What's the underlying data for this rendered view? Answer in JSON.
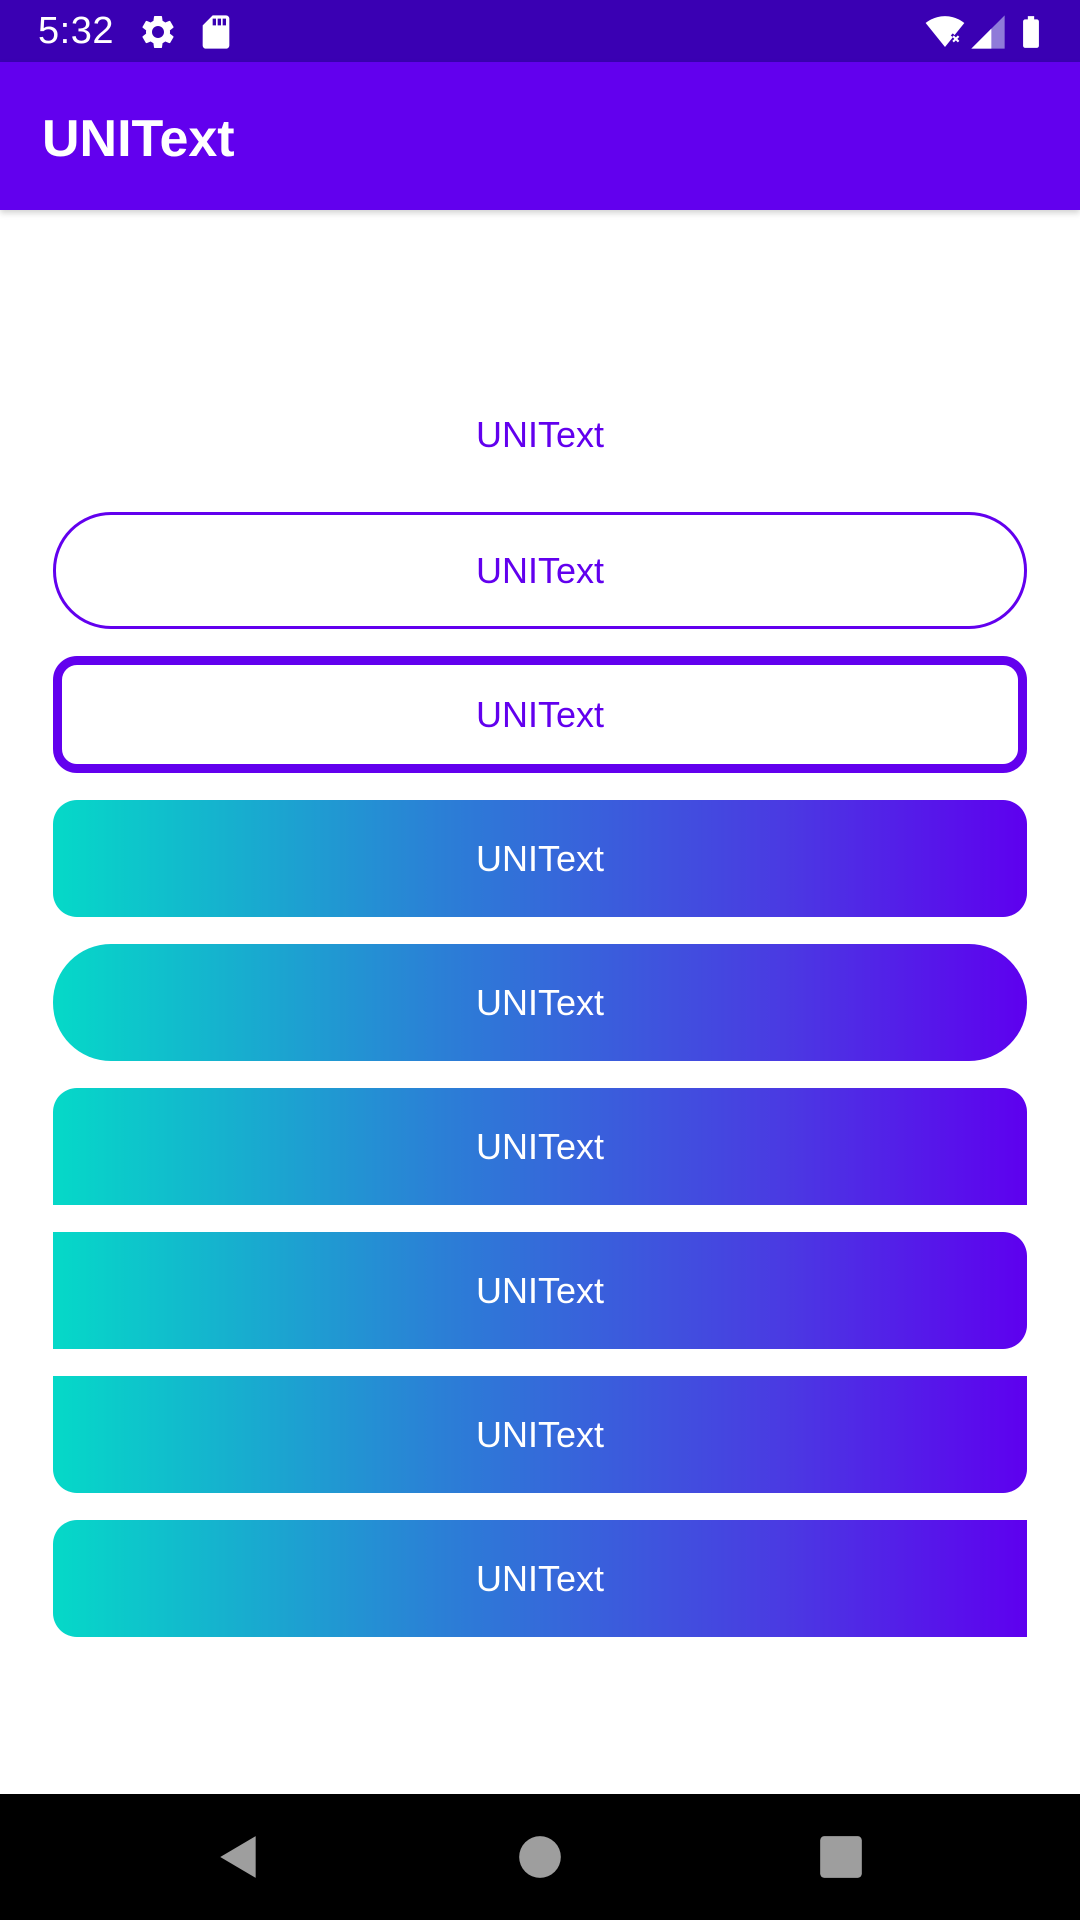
{
  "status_bar": {
    "time": "5:32",
    "icons": [
      "settings-icon",
      "sd-card-icon",
      "wifi-icon",
      "cell-signal-icon",
      "battery-icon"
    ],
    "background": "#3a00b3"
  },
  "app_bar": {
    "title": "UNIText",
    "background": "#6200ee"
  },
  "content": {
    "plain_text": "UNIText",
    "buttons": [
      {
        "label": "UNIText",
        "style": "outline-pill"
      },
      {
        "label": "UNIText",
        "style": "outline-thick-rounded"
      },
      {
        "label": "UNIText",
        "style": "gradient-rounded"
      },
      {
        "label": "UNIText",
        "style": "gradient-pill"
      },
      {
        "label": "UNIText",
        "style": "gradient-top-rounded"
      },
      {
        "label": "UNIText",
        "style": "gradient-top-right-bottom-right-rounded"
      },
      {
        "label": "UNIText",
        "style": "gradient-bottom-rounded"
      },
      {
        "label": "UNIText",
        "style": "gradient-left-rounded"
      }
    ],
    "accent_color": "#6200ee",
    "gradient_colors": [
      "#05d9c8",
      "#5e00ef"
    ]
  },
  "nav_bar": {
    "icons": [
      "back-icon",
      "home-icon",
      "recents-icon"
    ]
  }
}
